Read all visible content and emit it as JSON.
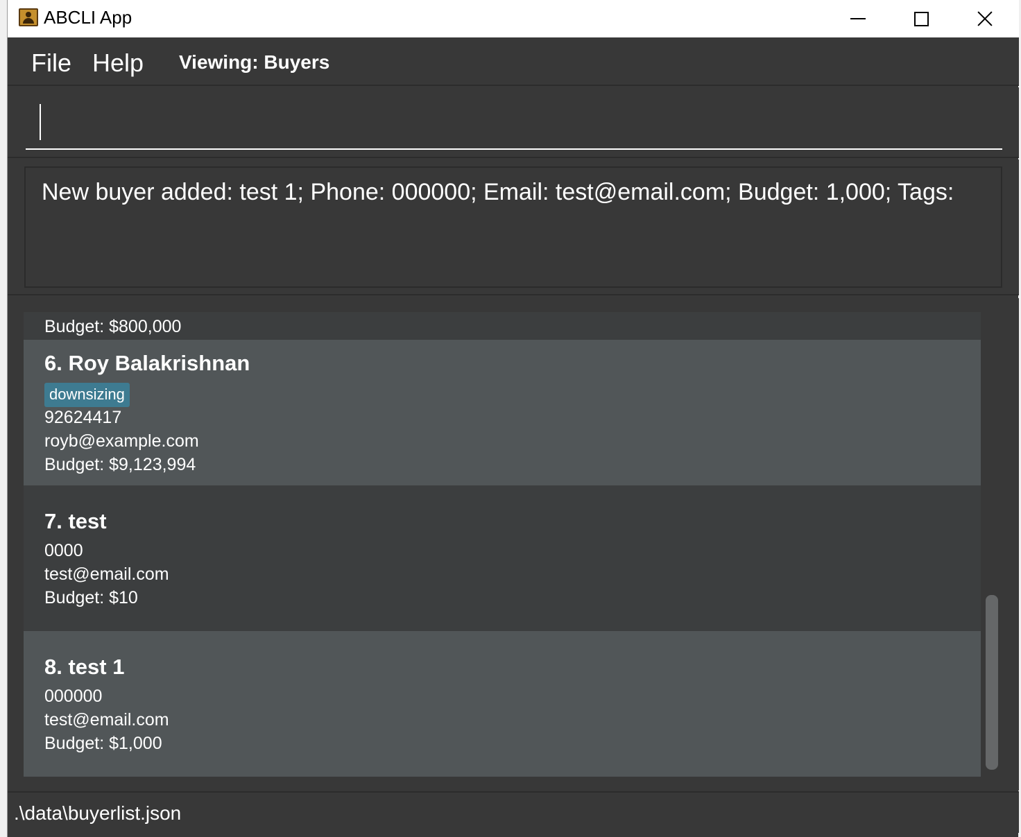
{
  "window": {
    "title": "ABCLI App",
    "icon": "contact-book-icon"
  },
  "menu": {
    "file": "File",
    "help": "Help",
    "viewing": "Viewing: Buyers"
  },
  "command": {
    "value": "",
    "placeholder": ""
  },
  "result": {
    "message": "New buyer added: test 1; Phone: 000000; Email: test@email.com; Budget: 1,000; Tags:"
  },
  "buyers": {
    "partial": {
      "budget": "Budget: $800,000"
    },
    "roy": {
      "name": "6. Roy Balakrishnan",
      "tag": "downsizing",
      "phone": "92624417",
      "email": "royb@example.com",
      "budget": "Budget: $9,123,994"
    },
    "test": {
      "name": "7. test",
      "phone": "0000",
      "email": "test@email.com",
      "budget": "Budget: $10"
    },
    "test1": {
      "name": "8. test 1",
      "phone": "000000",
      "email": "test@email.com",
      "budget": "Budget: $1,000"
    }
  },
  "status": {
    "file_path": ".\\data\\buyerlist.json"
  },
  "colors": {
    "background": "#383838",
    "card_dark": "#3c3e3f",
    "card_light": "#515658",
    "tag": "#3e7b91"
  }
}
